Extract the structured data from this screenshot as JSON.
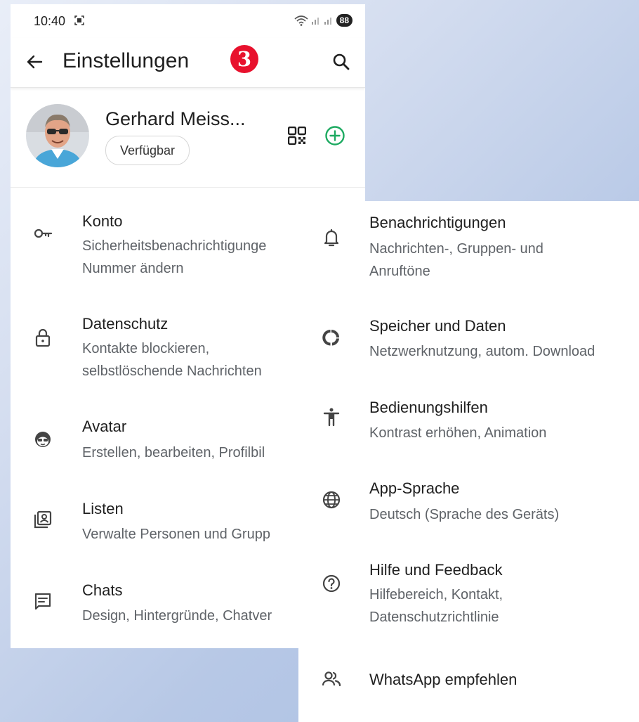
{
  "status_bar": {
    "time": "10:40",
    "battery": "88"
  },
  "app_bar": {
    "title": "Einstellungen",
    "step_badge": "3"
  },
  "profile": {
    "name": "Gerhard Meiss...",
    "status": "Verfügbar"
  },
  "settings_left": [
    {
      "icon": "key-icon",
      "title": "Konto",
      "subtitle": "Sicherheitsbenachrichtigunge\nNummer ändern"
    },
    {
      "icon": "lock-icon",
      "title": "Datenschutz",
      "subtitle": "Kontakte blockieren,\nselbstlöschende Nachrichten"
    },
    {
      "icon": "avatar-face-icon",
      "title": "Avatar",
      "subtitle": "Erstellen, bearbeiten, Profilbil"
    },
    {
      "icon": "contact-list-icon",
      "title": "Listen",
      "subtitle": "Verwalte Personen und Grupp"
    },
    {
      "icon": "chat-icon",
      "title": "Chats",
      "subtitle": "Design, Hintergründe, Chatver"
    }
  ],
  "settings_right": [
    {
      "icon": "bell-icon",
      "title": "Benachrichtigungen",
      "subtitle": "Nachrichten-, Gruppen- und\nAnruftöne"
    },
    {
      "icon": "storage-circle-icon",
      "title": "Speicher und Daten",
      "subtitle": "Netzwerknutzung, autom. Download"
    },
    {
      "icon": "accessibility-icon",
      "title": "Bedienungshilfen",
      "subtitle": "Kontrast erhöhen, Animation"
    },
    {
      "icon": "globe-icon",
      "title": "App-Sprache",
      "subtitle": "Deutsch (Sprache des Geräts)"
    },
    {
      "icon": "help-icon",
      "title": "Hilfe und Feedback",
      "subtitle": "Hilfebereich, Kontakt,\nDatenschutzrichtlinie"
    },
    {
      "icon": "people-icon",
      "title": "WhatsApp empfehlen",
      "subtitle": ""
    }
  ],
  "colors": {
    "step_badge": "#e8112d",
    "add_icon": "#1daa61",
    "text_primary": "#1f1f1f",
    "text_secondary": "#5f6368"
  }
}
